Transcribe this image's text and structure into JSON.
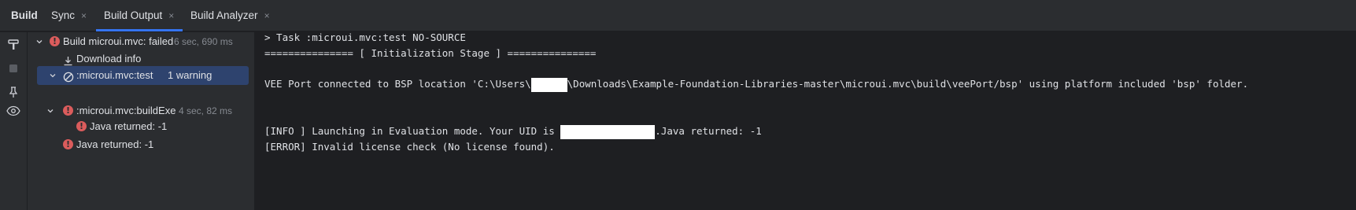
{
  "tabbar": {
    "title": "Build",
    "tabs": [
      {
        "label": "Sync",
        "active": false
      },
      {
        "label": "Build Output",
        "active": true
      },
      {
        "label": "Build Analyzer",
        "active": false
      }
    ],
    "close_glyph": "×"
  },
  "toolstrip": {
    "icons": [
      "hammer-icon",
      "stop-icon",
      "pin-icon",
      "eye-icon"
    ]
  },
  "tree": {
    "root": {
      "label": "Build microui.mvc:",
      "status": "failed",
      "time": "6 sec, 690 ms"
    },
    "download": {
      "label": "Download info"
    },
    "test_task": {
      "label": ":microui.mvc:test",
      "warning": "1 warning"
    },
    "exec_task": {
      "label": ":microui.mvc:buildExec",
      "time": "4 sec, 82 ms"
    },
    "exec_error": {
      "label": "Java returned: -1"
    },
    "root_error": {
      "label": "Java returned: -1"
    }
  },
  "console": {
    "line1": "> Task :microui.mvc:test NO-SOURCE",
    "line2": "=============== [ Initialization Stage ] ===============",
    "line3_a": "VEE Port connected to BSP location 'C:\\Users\\",
    "line3_b": "\\Downloads\\Example-Foundation-Libraries-master\\microui.mvc\\build\\veePort/bsp' using platform included 'bsp' folder.",
    "line4_a": "[INFO ] Launching in Evaluation mode. Your UID is ",
    "line4_b": ".Java returned: -1",
    "line5": "[ERROR] Invalid license check (No license found)."
  },
  "colors": {
    "background": "#1e1f22",
    "panel": "#2b2d30",
    "accent": "#3574f0",
    "error": "#db5c5c",
    "selection": "#2e436e"
  }
}
